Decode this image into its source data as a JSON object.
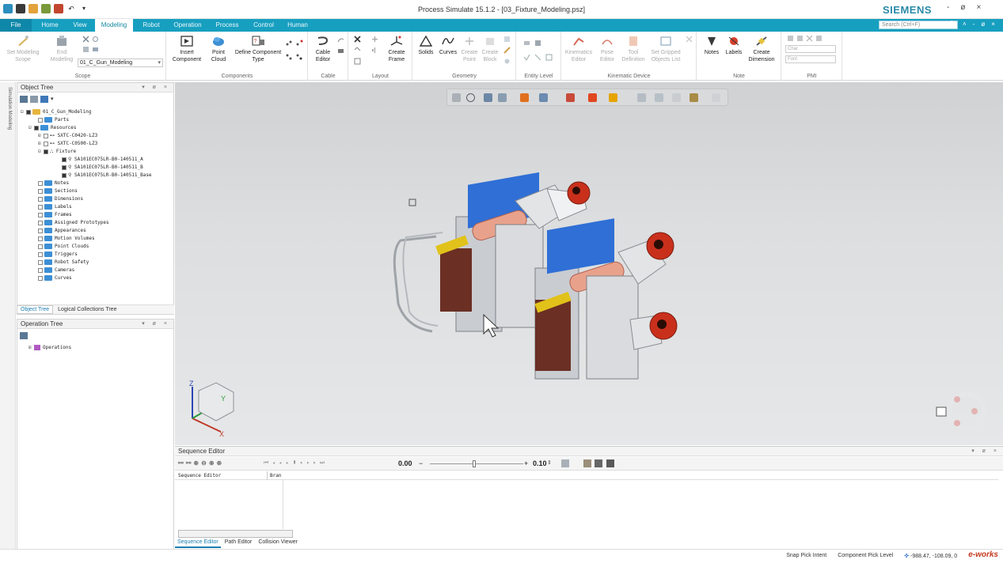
{
  "window": {
    "title": "Process Simulate 15.1.2 - [03_Fixture_Modeling.psz]",
    "brand": "SIEMENS",
    "controls": [
      "-",
      "ø",
      "×"
    ]
  },
  "menu": {
    "tabs": [
      "File",
      "Home",
      "View",
      "Modeling",
      "Robot",
      "Operation",
      "Process",
      "Control",
      "Human"
    ],
    "active": "Modeling",
    "search_placeholder": "Search (Ctrl+F)",
    "right_controls": [
      "˄",
      "-",
      "ø",
      "×"
    ]
  },
  "ribbon": {
    "scope": {
      "label": "Scope",
      "set_modeling_scope": "Set Modeling Scope",
      "end_modeling": "End Modeling",
      "current": "01_C_Gun_Modeling"
    },
    "components": {
      "label": "Components",
      "insert_component": "Insert Component",
      "point_cloud": "Point Cloud",
      "define_component_type": "Define Component Type"
    },
    "cable": {
      "label": "Cable",
      "cable_editor": "Cable Editor"
    },
    "layout": {
      "label": "Layout",
      "create_frame": "Create Frame"
    },
    "geometry": {
      "label": "Geometry",
      "solids": "Solids",
      "curves": "Curves",
      "create_point": "Create Point",
      "create_block": "Create Block"
    },
    "entity_level": {
      "label": "Entity Level"
    },
    "kinematic_device": {
      "label": "Kinematic Device",
      "kinematics_editor": "Kinematics Editor",
      "pose_editor": "Pose Editor",
      "tool_definition": "Tool Definition",
      "set_gripped_objects_list": "Set Gripped Objects List"
    },
    "note": {
      "label": "Note",
      "notes": "Notes",
      "labels": "Labels",
      "create_dimension": "Create Dimension"
    },
    "pmi": {
      "label": "PMI",
      "combo1": "Char",
      "combo2": "Font"
    }
  },
  "left_strip": {
    "text": "Simulation Modeling"
  },
  "object_tree": {
    "title": "Object Tree",
    "panel_controls": "▾ ø ×",
    "root": "01_C_Gun_Modeling",
    "items": [
      {
        "label": "Parts",
        "level": 2
      },
      {
        "label": "Resources",
        "level": 2
      },
      {
        "label": "SXTC-C0420-LZ3",
        "level": 3
      },
      {
        "label": "SXTC-C0500-LZ3",
        "level": 3
      },
      {
        "label": "Fixture",
        "level": 3
      },
      {
        "label": "SA101EC075LR-B0-140511_A",
        "level": 4
      },
      {
        "label": "SA101EC075LR-B0-140511_B",
        "level": 4
      },
      {
        "label": "SA101EC075LR-B0-140511_Base",
        "level": 4
      },
      {
        "label": "Notes",
        "level": 2
      },
      {
        "label": "Sections",
        "level": 2
      },
      {
        "label": "Dimensions",
        "level": 2
      },
      {
        "label": "Labels",
        "level": 2
      },
      {
        "label": "Frames",
        "level": 2
      },
      {
        "label": "Assigned Prototypes",
        "level": 2
      },
      {
        "label": "Appearances",
        "level": 2
      },
      {
        "label": "Motion Volumes",
        "level": 2
      },
      {
        "label": "Point Clouds",
        "level": 2
      },
      {
        "label": "Triggers",
        "level": 2
      },
      {
        "label": "Robot Safety",
        "level": 2
      },
      {
        "label": "Cameras",
        "level": 2
      },
      {
        "label": "Curves",
        "level": 2
      }
    ],
    "bottom_tabs": [
      "Object Tree",
      "Logical Collections Tree"
    ]
  },
  "operation_tree": {
    "title": "Operation Tree",
    "panel_controls": "▾ ø ×",
    "root": "Operations"
  },
  "viewport": {
    "axes": {
      "x": "X",
      "y": "Y",
      "z": "Z"
    }
  },
  "sequence_editor": {
    "title": "Sequence Editor",
    "panel_controls": "▾ ø ×",
    "time_value": "0.00",
    "step_value": "0.10",
    "columns": [
      "Sequence Editor",
      "Bran"
    ],
    "bottom_tabs": [
      "Sequence Editor",
      "Path Editor",
      "Collision Viewer"
    ]
  },
  "statusbar": {
    "snap": "Snap Pick Intent",
    "pick_level": "Component Pick Level",
    "coords": "-988.47, -108.09, 0",
    "watermark": "e-works"
  },
  "colors": {
    "accent": "#179fc0",
    "brand": "#2a8aa8",
    "part_blue": "#2f6fd6",
    "part_grey": "#cfd2d6",
    "part_red": "#c9301c",
    "part_yellow": "#e1c21a",
    "part_pink": "#e8a28c",
    "part_brown": "#6b2f24"
  }
}
